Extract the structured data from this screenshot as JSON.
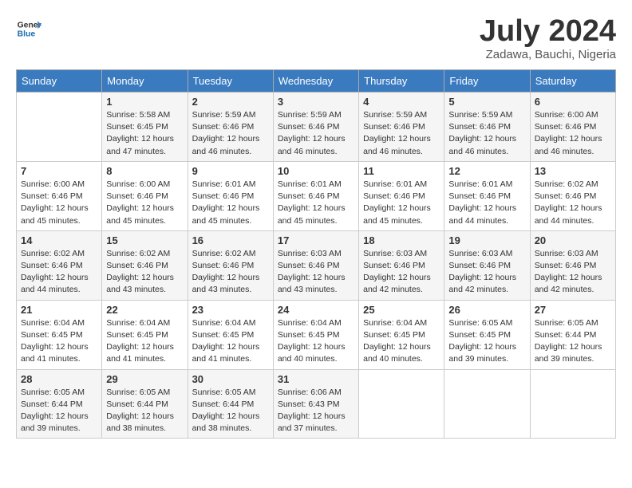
{
  "header": {
    "logo_line1": "General",
    "logo_line2": "Blue",
    "month_title": "July 2024",
    "location": "Zadawa, Bauchi, Nigeria"
  },
  "days_of_week": [
    "Sunday",
    "Monday",
    "Tuesday",
    "Wednesday",
    "Thursday",
    "Friday",
    "Saturday"
  ],
  "weeks": [
    [
      {
        "day": "",
        "info": ""
      },
      {
        "day": "1",
        "info": "Sunrise: 5:58 AM\nSunset: 6:45 PM\nDaylight: 12 hours\nand 47 minutes."
      },
      {
        "day": "2",
        "info": "Sunrise: 5:59 AM\nSunset: 6:46 PM\nDaylight: 12 hours\nand 46 minutes."
      },
      {
        "day": "3",
        "info": "Sunrise: 5:59 AM\nSunset: 6:46 PM\nDaylight: 12 hours\nand 46 minutes."
      },
      {
        "day": "4",
        "info": "Sunrise: 5:59 AM\nSunset: 6:46 PM\nDaylight: 12 hours\nand 46 minutes."
      },
      {
        "day": "5",
        "info": "Sunrise: 5:59 AM\nSunset: 6:46 PM\nDaylight: 12 hours\nand 46 minutes."
      },
      {
        "day": "6",
        "info": "Sunrise: 6:00 AM\nSunset: 6:46 PM\nDaylight: 12 hours\nand 46 minutes."
      }
    ],
    [
      {
        "day": "7",
        "info": "Sunrise: 6:00 AM\nSunset: 6:46 PM\nDaylight: 12 hours\nand 45 minutes."
      },
      {
        "day": "8",
        "info": "Sunrise: 6:00 AM\nSunset: 6:46 PM\nDaylight: 12 hours\nand 45 minutes."
      },
      {
        "day": "9",
        "info": "Sunrise: 6:01 AM\nSunset: 6:46 PM\nDaylight: 12 hours\nand 45 minutes."
      },
      {
        "day": "10",
        "info": "Sunrise: 6:01 AM\nSunset: 6:46 PM\nDaylight: 12 hours\nand 45 minutes."
      },
      {
        "day": "11",
        "info": "Sunrise: 6:01 AM\nSunset: 6:46 PM\nDaylight: 12 hours\nand 45 minutes."
      },
      {
        "day": "12",
        "info": "Sunrise: 6:01 AM\nSunset: 6:46 PM\nDaylight: 12 hours\nand 44 minutes."
      },
      {
        "day": "13",
        "info": "Sunrise: 6:02 AM\nSunset: 6:46 PM\nDaylight: 12 hours\nand 44 minutes."
      }
    ],
    [
      {
        "day": "14",
        "info": "Sunrise: 6:02 AM\nSunset: 6:46 PM\nDaylight: 12 hours\nand 44 minutes."
      },
      {
        "day": "15",
        "info": "Sunrise: 6:02 AM\nSunset: 6:46 PM\nDaylight: 12 hours\nand 43 minutes."
      },
      {
        "day": "16",
        "info": "Sunrise: 6:02 AM\nSunset: 6:46 PM\nDaylight: 12 hours\nand 43 minutes."
      },
      {
        "day": "17",
        "info": "Sunrise: 6:03 AM\nSunset: 6:46 PM\nDaylight: 12 hours\nand 43 minutes."
      },
      {
        "day": "18",
        "info": "Sunrise: 6:03 AM\nSunset: 6:46 PM\nDaylight: 12 hours\nand 42 minutes."
      },
      {
        "day": "19",
        "info": "Sunrise: 6:03 AM\nSunset: 6:46 PM\nDaylight: 12 hours\nand 42 minutes."
      },
      {
        "day": "20",
        "info": "Sunrise: 6:03 AM\nSunset: 6:46 PM\nDaylight: 12 hours\nand 42 minutes."
      }
    ],
    [
      {
        "day": "21",
        "info": "Sunrise: 6:04 AM\nSunset: 6:45 PM\nDaylight: 12 hours\nand 41 minutes."
      },
      {
        "day": "22",
        "info": "Sunrise: 6:04 AM\nSunset: 6:45 PM\nDaylight: 12 hours\nand 41 minutes."
      },
      {
        "day": "23",
        "info": "Sunrise: 6:04 AM\nSunset: 6:45 PM\nDaylight: 12 hours\nand 41 minutes."
      },
      {
        "day": "24",
        "info": "Sunrise: 6:04 AM\nSunset: 6:45 PM\nDaylight: 12 hours\nand 40 minutes."
      },
      {
        "day": "25",
        "info": "Sunrise: 6:04 AM\nSunset: 6:45 PM\nDaylight: 12 hours\nand 40 minutes."
      },
      {
        "day": "26",
        "info": "Sunrise: 6:05 AM\nSunset: 6:45 PM\nDaylight: 12 hours\nand 39 minutes."
      },
      {
        "day": "27",
        "info": "Sunrise: 6:05 AM\nSunset: 6:44 PM\nDaylight: 12 hours\nand 39 minutes."
      }
    ],
    [
      {
        "day": "28",
        "info": "Sunrise: 6:05 AM\nSunset: 6:44 PM\nDaylight: 12 hours\nand 39 minutes."
      },
      {
        "day": "29",
        "info": "Sunrise: 6:05 AM\nSunset: 6:44 PM\nDaylight: 12 hours\nand 38 minutes."
      },
      {
        "day": "30",
        "info": "Sunrise: 6:05 AM\nSunset: 6:44 PM\nDaylight: 12 hours\nand 38 minutes."
      },
      {
        "day": "31",
        "info": "Sunrise: 6:06 AM\nSunset: 6:43 PM\nDaylight: 12 hours\nand 37 minutes."
      },
      {
        "day": "",
        "info": ""
      },
      {
        "day": "",
        "info": ""
      },
      {
        "day": "",
        "info": ""
      }
    ]
  ]
}
